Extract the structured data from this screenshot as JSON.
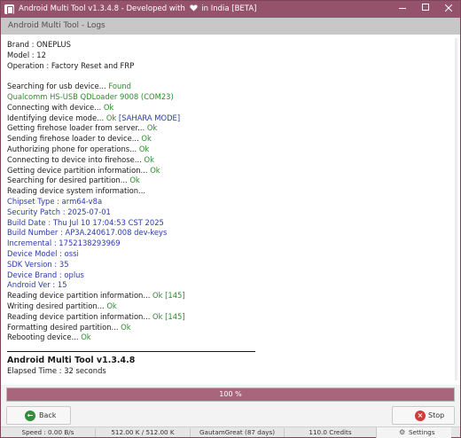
{
  "window": {
    "title": "Android Multi Tool v1.3.4.8 - Developed with",
    "title_suffix": "in India [BETA]",
    "heart_icon": "heart-icon"
  },
  "header": {
    "subtitle": "Android Multi Tool - Logs"
  },
  "log": {
    "lines": [
      [
        {
          "t": "Brand : ONEPLUS",
          "c": "black"
        }
      ],
      [
        {
          "t": "Model : 12",
          "c": "black"
        }
      ],
      [
        {
          "t": "Operation : Factory Reset and FRP",
          "c": "black"
        }
      ],
      [
        {
          "t": "",
          "c": "black"
        }
      ],
      [
        {
          "t": "Searching for usb device... ",
          "c": "black"
        },
        {
          "t": "Found",
          "c": "green"
        }
      ],
      [
        {
          "t": "Qualcomm HS-USB QDLoader 9008 (COM23)",
          "c": "green"
        }
      ],
      [
        {
          "t": "Connecting with device... ",
          "c": "black"
        },
        {
          "t": "Ok",
          "c": "green"
        }
      ],
      [
        {
          "t": "Identifying device mode... ",
          "c": "black"
        },
        {
          "t": "Ok",
          "c": "green"
        },
        {
          "t": " [SAHARA MODE]",
          "c": "blue"
        }
      ],
      [
        {
          "t": "Getting firehose loader from server... ",
          "c": "black"
        },
        {
          "t": "Ok",
          "c": "green"
        }
      ],
      [
        {
          "t": "Sending firehose loader to device... ",
          "c": "black"
        },
        {
          "t": "Ok",
          "c": "green"
        }
      ],
      [
        {
          "t": "Authorizing phone for operations... ",
          "c": "black"
        },
        {
          "t": "Ok",
          "c": "green"
        }
      ],
      [
        {
          "t": "Connecting to device into firehose... ",
          "c": "black"
        },
        {
          "t": "Ok",
          "c": "green"
        }
      ],
      [
        {
          "t": "Getting device partition information... ",
          "c": "black"
        },
        {
          "t": "Ok",
          "c": "green"
        }
      ],
      [
        {
          "t": "Searching for desired partition... ",
          "c": "black"
        },
        {
          "t": "Ok",
          "c": "green"
        }
      ],
      [
        {
          "t": "Reading device system information...",
          "c": "black"
        }
      ],
      [
        {
          "t": "Chipset Type : arm64-v8a",
          "c": "blue"
        }
      ],
      [
        {
          "t": "Security Patch : 2025-07-01",
          "c": "blue"
        }
      ],
      [
        {
          "t": "Build Date : Thu Jul 10 17:04:53 CST 2025",
          "c": "blue"
        }
      ],
      [
        {
          "t": "Build Number : AP3A.240617.008 dev-keys",
          "c": "blue"
        }
      ],
      [
        {
          "t": "Incremental : 1752138293969",
          "c": "blue"
        }
      ],
      [
        {
          "t": "Device Model : ossi",
          "c": "blue"
        }
      ],
      [
        {
          "t": "SDK Version : 35",
          "c": "blue"
        }
      ],
      [
        {
          "t": "Device Brand : oplus",
          "c": "blue"
        }
      ],
      [
        {
          "t": "Android Ver : 15",
          "c": "blue"
        }
      ],
      [
        {
          "t": "Reading device partition information... ",
          "c": "black"
        },
        {
          "t": "Ok [145]",
          "c": "green"
        }
      ],
      [
        {
          "t": "Writing desired partition... ",
          "c": "black"
        },
        {
          "t": "Ok",
          "c": "green"
        }
      ],
      [
        {
          "t": "Reading device partition information... ",
          "c": "black"
        },
        {
          "t": "Ok [145]",
          "c": "green"
        }
      ],
      [
        {
          "t": "Formatting desired partition... ",
          "c": "black"
        },
        {
          "t": "Ok",
          "c": "green"
        }
      ],
      [
        {
          "t": "Rebooting device... ",
          "c": "black"
        },
        {
          "t": "Ok",
          "c": "green"
        }
      ]
    ],
    "version_title": "Android Multi Tool v1.3.4.8",
    "elapsed": "Elapsed Time : 32 seconds"
  },
  "progress": {
    "value": 1.0,
    "label": "100 %"
  },
  "actions": {
    "back_label": "Back",
    "stop_label": "Stop"
  },
  "status": {
    "speed": "Speed : 0.00 B/s",
    "transfer": "512.00 K / 512.00 K",
    "user": "GautamGreat (87 days)",
    "credits": "110.0 Credits",
    "settings_label": "Settings"
  },
  "colors": {
    "accent": "#94536a",
    "progress": "#a8667d",
    "ok_green": "#2e8b2e",
    "info_blue": "#2a3aa8",
    "stop_red": "#d43a3a",
    "back_green": "#2f8f3a"
  }
}
